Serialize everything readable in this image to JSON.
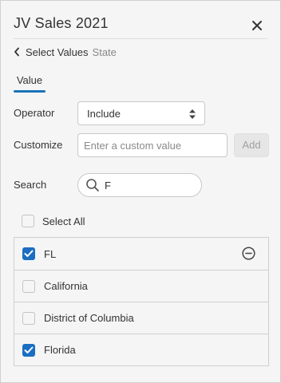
{
  "header": {
    "title": "JV Sales 2021",
    "close_icon": "close-icon"
  },
  "breadcrumb": {
    "back_label": "Select Values",
    "field_name": "State"
  },
  "tabs": [
    {
      "label": "Value",
      "active": true
    }
  ],
  "operator": {
    "label": "Operator",
    "value": "Include"
  },
  "customize": {
    "label": "Customize",
    "placeholder": "Enter a custom value",
    "add_label": "Add"
  },
  "search": {
    "label": "Search",
    "value": "F"
  },
  "select_all": {
    "label": "Select All",
    "checked": false
  },
  "values": [
    {
      "label": "FL",
      "checked": true,
      "removable": true
    },
    {
      "label": "California",
      "checked": false,
      "removable": false
    },
    {
      "label": "District of Columbia",
      "checked": false,
      "removable": false
    },
    {
      "label": "Florida",
      "checked": true,
      "removable": false
    }
  ],
  "colors": {
    "accent": "#1b6ec2",
    "tab_underline": "#1a73b8",
    "background": "#f5f5f5"
  }
}
